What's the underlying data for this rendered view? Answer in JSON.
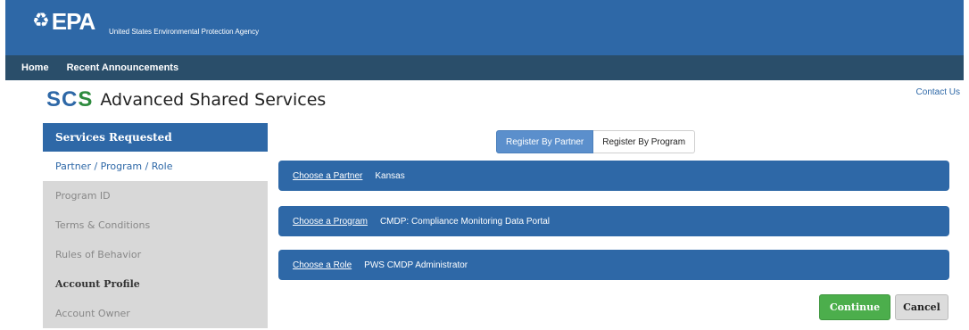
{
  "header": {
    "logo_mark": "♻",
    "logo_text": "EPA",
    "agency_name": "United States Environmental Protection Agency"
  },
  "nav": {
    "items": [
      {
        "label": "Home"
      },
      {
        "label": "Recent Announcements"
      }
    ]
  },
  "app": {
    "logo_sc": "SC",
    "logo_s": "S",
    "title": "Advanced Shared Services",
    "contact_label": "Contact Us"
  },
  "sidebar": {
    "heading": "Services Requested",
    "items": [
      {
        "label": "Partner / Program / Role"
      },
      {
        "label": "Program ID"
      },
      {
        "label": "Terms & Conditions"
      },
      {
        "label": "Rules of Behavior"
      },
      {
        "label": "Account Profile"
      },
      {
        "label": "Account Owner"
      }
    ]
  },
  "register_toggle": {
    "options": [
      {
        "label": "Register By Partner",
        "selected": true
      },
      {
        "label": "Register By Program",
        "selected": false
      }
    ]
  },
  "choices": [
    {
      "link": "Choose a Partner",
      "value": "Kansas"
    },
    {
      "link": "Choose a Program",
      "value": "CMDP: Compliance Monitoring Data Portal"
    },
    {
      "link": "Choose a Role",
      "value": "PWS CMDP Administrator"
    }
  ],
  "actions": {
    "continue_label": "Continue",
    "cancel_label": "Cancel"
  },
  "colors": {
    "brand_blue": "#2e68a7",
    "nav_dark": "#2a4e6a",
    "continue_green": "#4cae4c",
    "sidebar_gray": "#d8d8d8"
  }
}
